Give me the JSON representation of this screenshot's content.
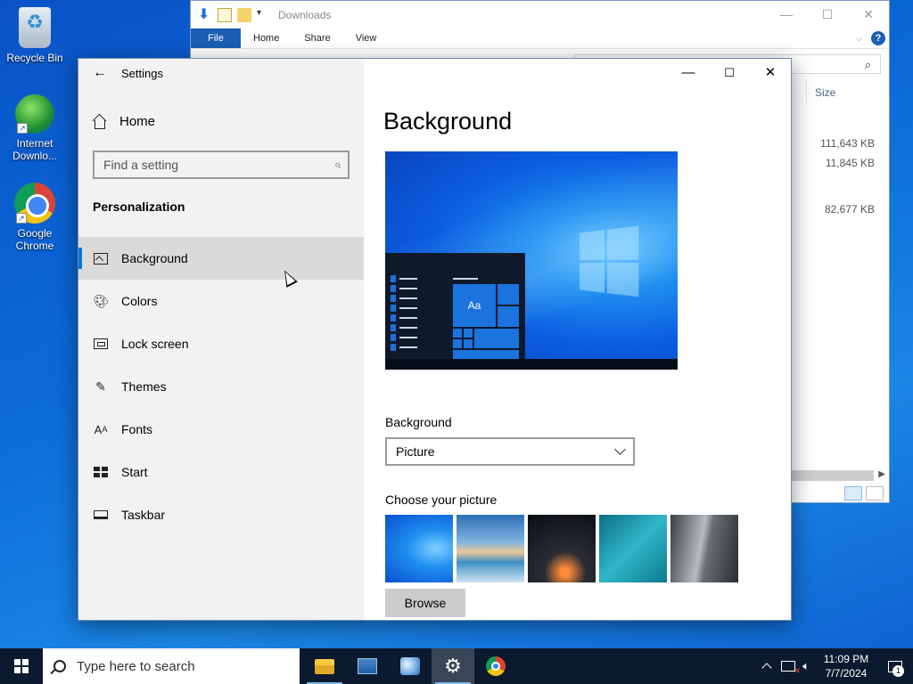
{
  "desktop": {
    "icons": [
      {
        "label": "Recycle Bin"
      },
      {
        "label": "Internet Downlo..."
      },
      {
        "label": "Google Chrome"
      }
    ]
  },
  "explorer": {
    "title": "Downloads",
    "ribbon_tabs": [
      "File",
      "Home",
      "Share",
      "View"
    ],
    "column_size": "Size",
    "sizes": [
      "111,643 KB",
      "11,845 KB",
      "82,677 KB"
    ]
  },
  "settings": {
    "app_title": "Settings",
    "home_label": "Home",
    "search_placeholder": "Find a setting",
    "section": "Personalization",
    "nav": [
      {
        "label": "Background",
        "icon": "picture-icon"
      },
      {
        "label": "Colors",
        "icon": "palette-icon"
      },
      {
        "label": "Lock screen",
        "icon": "lock-screen-icon"
      },
      {
        "label": "Themes",
        "icon": "brush-icon"
      },
      {
        "label": "Fonts",
        "icon": "font-icon"
      },
      {
        "label": "Start",
        "icon": "start-icon"
      },
      {
        "label": "Taskbar",
        "icon": "taskbar-icon"
      }
    ],
    "active_nav": "Background",
    "page_title": "Background",
    "preview_tile_text": "Aa",
    "background_label": "Background",
    "background_value": "Picture",
    "choose_label": "Choose your picture",
    "browse_label": "Browse"
  },
  "taskbar": {
    "search_placeholder": "Type here to search",
    "time": "11:09 PM",
    "date": "7/7/2024",
    "notification_count": "1"
  },
  "colors": {
    "accent": "#0078d7",
    "taskbar": "#0b1a2e",
    "sidebar": "#f2f2f2"
  }
}
